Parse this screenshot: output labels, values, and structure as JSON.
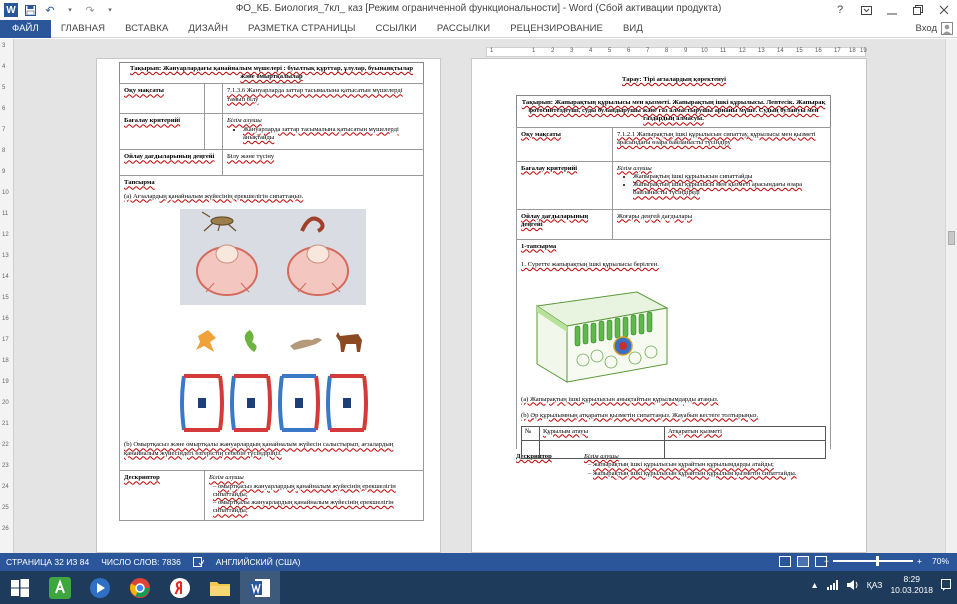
{
  "window": {
    "title": "ФО_КБ. Биология_7кл_ каз [Режим ограниченной функциональности] - Word (Сбой активации продукта)",
    "help": "?",
    "login": "Вход"
  },
  "qat": {
    "save_icon": "save-icon",
    "undo_icon": "undo-icon",
    "redo_icon": "redo-icon"
  },
  "ribbon": {
    "tabs": [
      "ФАЙЛ",
      "ГЛАВНАЯ",
      "ВСТАВКА",
      "ДИЗАЙН",
      "РАЗМЕТКА СТРАНИЦЫ",
      "ССЫЛКИ",
      "РАССЫЛКИ",
      "РЕЦЕНЗИРОВАНИЕ",
      "ВИД"
    ]
  },
  "vruler": [
    "3",
    "4",
    "5",
    "6",
    "7",
    "8",
    "9",
    "10",
    "11",
    "12",
    "13",
    "14",
    "15",
    "16",
    "17",
    "18",
    "19",
    "20",
    "21",
    "22",
    "23",
    "24",
    "25",
    "26"
  ],
  "hruler": [
    "1",
    "1",
    "2",
    "3",
    "4",
    "5",
    "6",
    "7",
    "8",
    "9",
    "10",
    "11",
    "12",
    "13",
    "14",
    "15",
    "16",
    "17",
    "18",
    "19"
  ],
  "left_page": {
    "topic": "Тақырып: Жануарлардағы қанайналым мүшелері : буылтық құрттар, ұлулар, буынаяқтылар және омыртқалылар",
    "rows": [
      {
        "label": "Оқу мақсаты",
        "value": "7.1.3.6 Жануарларда заттар тасымалына қатысатын мүшелерді тамып білу"
      },
      {
        "label": "Бағалау критерийі",
        "value_title": "Білім алушы",
        "bullets": [
          "Жануарларда заттар тасымалына қатысатын мүшелерді анықтайды"
        ]
      },
      {
        "label": "Ойлау дағдыларының деңгейі",
        "value": "Білу және түсіну"
      }
    ],
    "task_title": "Тапсырма",
    "task_a": "(a) Ағзалардың қанайналым жүйесінің ерекшелігін сипаттаңыз.",
    "task_b": "(b) Омыртқасыз және омыртқалы жануарлардың қанайналым жүйесін салыстырып, ағзалардың қанайналым жүйесіндегі өзгерістің себебін түсіндіріңіз.",
    "descriptor_label": "Дескриптор",
    "descriptor_title": "Білім алушы",
    "descriptor_items": [
      "омыртқасыз жануарлардың қанайналым жүйесінің ерекшелігін сипаттайды;",
      "омыртқалы жануарлардың қанайналым жүйесінің ерекшелігін сипаттайды;"
    ]
  },
  "right_page": {
    "section": "Тарау: Тірі ағзалардың қоректенуі",
    "topic": "Тақырып: Жапырақтың құрылысы мен қызметі. Жапырақтың ішкі құрылысы. Лептесік. Жапырақ фотосинтездеуші, суды буландырушы және газ алмастырушы арнайы мүше. Судың булануы мен газдардың алмасуы.",
    "rows": [
      {
        "label": "Оқу мақсаты",
        "value": "7.1.2.1 Жапырақтың ішкі құрылысын сипаттау, құрылысы мен қызметі арасындағы өзара байланысты түсіндіру"
      },
      {
        "label": "Бағалау критерийі",
        "value_title": "Білім алушы",
        "bullets": [
          "Жапырақтың ішкі құрылысын сипаттайды",
          "Жапырақтың ішкі құрылысы мен қызметі арасындағы өзара байланысты түсіндіреді"
        ]
      },
      {
        "label": "Ойлау дағдыларының деңгейі",
        "value": "Жоғары деңгей дағдылары"
      }
    ],
    "task_title": "1-тапсырма",
    "task_1": "1. Суретте жапырақтың ішкі құрылысы берілген.",
    "task_a": "(a) Жапырақтың ішкі құрылысын анықтайтын құрылымдарды атаңыз.",
    "task_b": "(b) Әр құрылымның атқаратын қызметін сипаттаңыз. Жауабын кестеге толтырыңыз.",
    "table_headers": [
      "№",
      "Құрылым атауы",
      "Атқаратын қызметі"
    ],
    "descriptor_label": "Дескриптор",
    "descriptor_title": "Білім алушы",
    "descriptor_items": [
      "жапырақтың ішкі құрылысын құрайтын құрылымдарды атайды;",
      "жапырақтың ішкі құрылысын құрайтын құрылым қызметін сипаттайды."
    ]
  },
  "status": {
    "page": "СТРАНИЦА 32 ИЗ 84",
    "words": "ЧИСЛО СЛОВ: 7836",
    "lang": "АНГЛИЙСКИЙ (США)",
    "zoom_minus": "−",
    "zoom_plus": "+",
    "zoom": "70%"
  },
  "taskbar": {
    "lang": "ҚАЗ",
    "time": "8:29",
    "date": "10.03.2018"
  },
  "colors": {
    "word_blue": "#2b579a",
    "taskbar": "#1f3b5c"
  }
}
